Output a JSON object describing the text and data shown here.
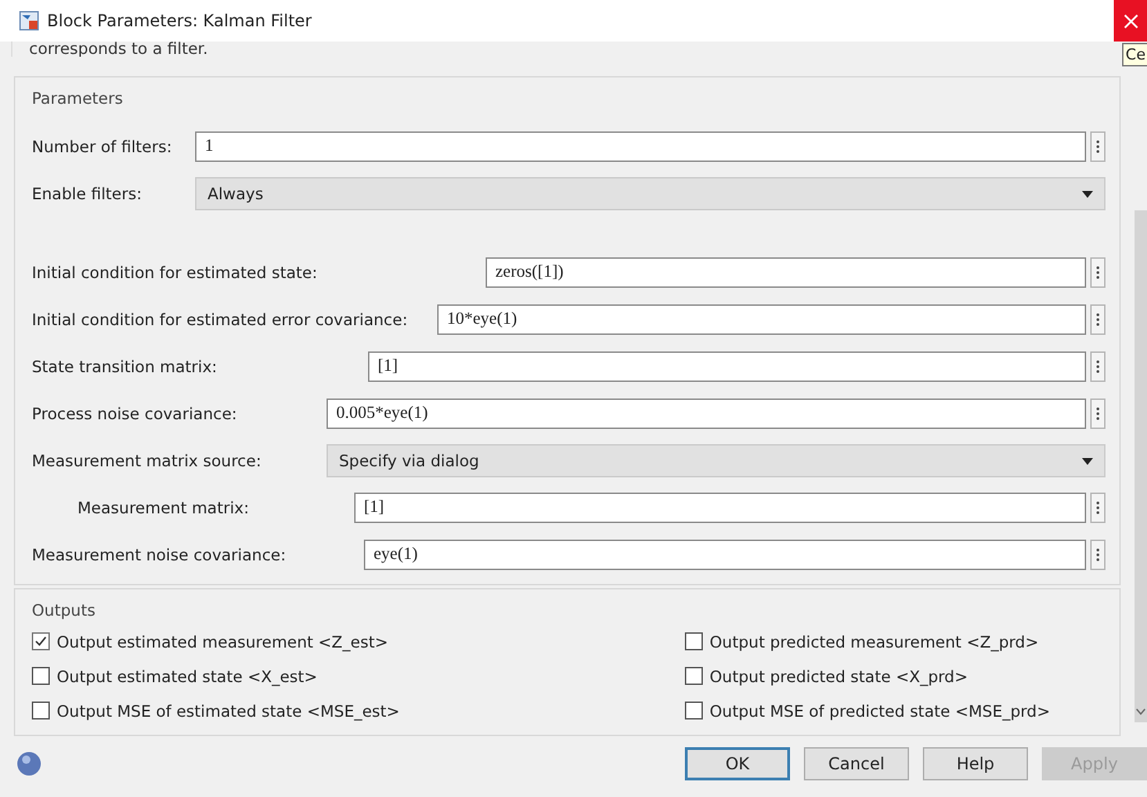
{
  "window": {
    "title": "Block Parameters: Kalman Filter",
    "tooltip": "Ce"
  },
  "description": "corresponds to a filter.",
  "parameters": {
    "title": "Parameters",
    "top_rows": [
      {
        "kind": "edit",
        "label": "Number of filters:",
        "value": "1"
      },
      {
        "kind": "popup",
        "label": "Enable filters:",
        "value": "Always"
      }
    ],
    "rows": [
      {
        "kind": "edit",
        "label": "Initial condition for estimated state:",
        "value": "zeros([1])"
      },
      {
        "kind": "edit",
        "label": "Initial condition for estimated error covariance:",
        "value": "10*eye(1)"
      },
      {
        "kind": "edit",
        "label": "State transition matrix:",
        "value": "[1]"
      },
      {
        "kind": "edit",
        "label": "Process noise covariance:",
        "value": "0.005*eye(1)"
      },
      {
        "kind": "popup",
        "label": "Measurement matrix source:",
        "value": "Specify via dialog",
        "children": [
          {
            "kind": "edit",
            "label": "Measurement matrix:",
            "value": "[1]"
          }
        ]
      },
      {
        "kind": "edit",
        "label": "Measurement noise covariance:",
        "value": "eye(1)"
      }
    ]
  },
  "outputs": {
    "title": "Outputs",
    "left": [
      {
        "label": "Output estimated measurement <Z_est>",
        "checked": true
      },
      {
        "label": "Output estimated state <X_est>",
        "checked": false
      },
      {
        "label": "Output MSE of estimated state <MSE_est>",
        "checked": false
      }
    ],
    "right": [
      {
        "label": "Output predicted measurement <Z_prd>",
        "checked": false
      },
      {
        "label": "Output predicted state <X_prd>",
        "checked": false
      },
      {
        "label": "Output MSE of predicted state <MSE_prd>",
        "checked": false
      }
    ]
  },
  "buttons": [
    {
      "label": "OK",
      "default": true,
      "disabled": false
    },
    {
      "label": "Cancel",
      "default": false,
      "disabled": false
    },
    {
      "label": "Help",
      "default": false,
      "disabled": false
    },
    {
      "label": "Apply",
      "default": false,
      "disabled": true
    }
  ]
}
